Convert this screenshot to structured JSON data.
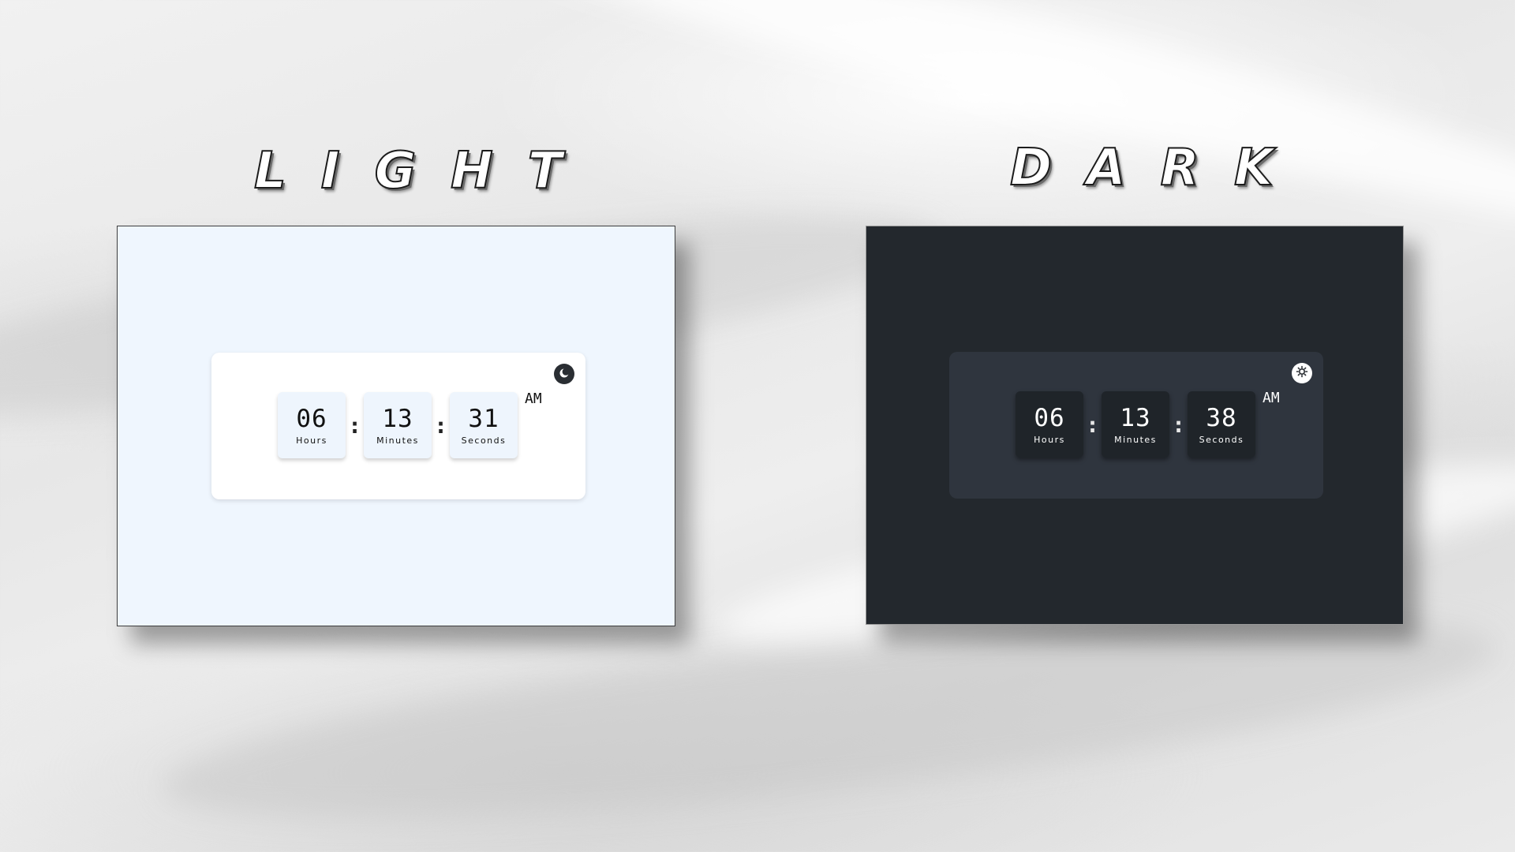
{
  "headings": {
    "light": "LIGHT",
    "dark": "DARK"
  },
  "light_clock": {
    "hours": "06",
    "hours_label": "Hours",
    "minutes": "13",
    "minutes_label": "Minutes",
    "seconds": "31",
    "seconds_label": "Seconds",
    "separator": ":",
    "period": "AM",
    "toggle_icon": "moon-icon"
  },
  "dark_clock": {
    "hours": "06",
    "hours_label": "Hours",
    "minutes": "13",
    "minutes_label": "Minutes",
    "seconds": "38",
    "seconds_label": "Seconds",
    "separator": ":",
    "period": "AM",
    "toggle_icon": "sun-icon"
  },
  "colors": {
    "light_page_bg": "#eff6fe",
    "light_card_bg": "#ffffff",
    "dark_page_bg": "#23282d",
    "dark_card_bg": "#2f353e",
    "dark_unit_bg": "#1f2429"
  }
}
